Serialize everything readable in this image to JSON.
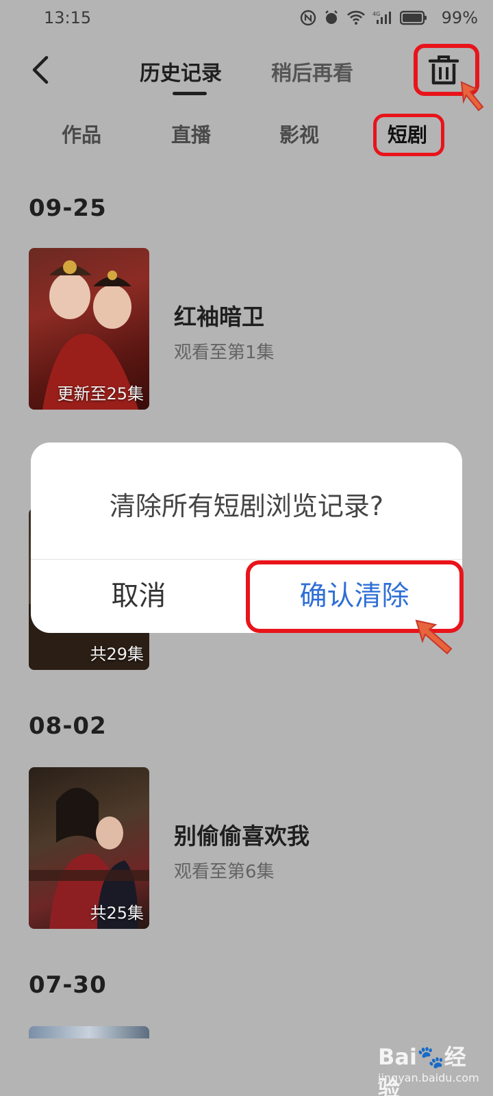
{
  "status_bar": {
    "time": "13:15",
    "battery": "99%"
  },
  "header": {
    "tabs": [
      {
        "label": "历史记录",
        "active": true
      },
      {
        "label": "稍后再看",
        "active": false
      }
    ]
  },
  "categories": [
    "作品",
    "直播",
    "影视",
    "短剧"
  ],
  "groups": [
    {
      "date": "09-25",
      "items": [
        {
          "title": "红袖暗卫",
          "progress": "观看至第1集",
          "badge": "更新至25集"
        }
      ]
    },
    {
      "items": [
        {
          "badge": "共29集"
        }
      ]
    },
    {
      "date": "08-02",
      "items": [
        {
          "title": "别偷偷喜欢我",
          "progress": "观看至第6集",
          "badge": "共25集"
        }
      ]
    },
    {
      "date": "07-30"
    }
  ],
  "dialog": {
    "message": "清除所有短剧浏览记录?",
    "cancel_label": "取消",
    "confirm_label": "确认清除"
  },
  "watermark": {
    "logo": "Bai🐾经验",
    "url": "jingyan.baidu.com"
  },
  "colors": {
    "highlight": "#e8141b",
    "confirm_text": "#2f6fd6",
    "overlay": "#b4b4b4"
  }
}
